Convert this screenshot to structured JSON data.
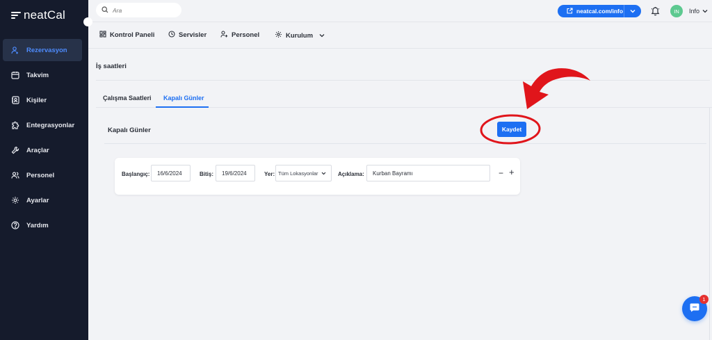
{
  "app": {
    "name": "neatCal"
  },
  "sidebar": {
    "items": [
      {
        "label": "Rezervasyon",
        "icon": "user-calendar-icon",
        "active": true
      },
      {
        "label": "Takvim",
        "icon": "calendar-icon"
      },
      {
        "label": "Kişiler",
        "icon": "contacts-icon"
      },
      {
        "label": "Entegrasyonlar",
        "icon": "puzzle-icon"
      },
      {
        "label": "Araçlar",
        "icon": "tools-icon"
      },
      {
        "label": "Personel",
        "icon": "users-icon"
      },
      {
        "label": "Ayarlar",
        "icon": "gear-icon"
      },
      {
        "label": "Yardım",
        "icon": "help-icon"
      }
    ]
  },
  "topbar": {
    "search_placeholder": "Ara",
    "url_label": "neatcal.com/info",
    "avatar_initials": "IN",
    "user_name": "Info"
  },
  "subnav": {
    "items": [
      {
        "label": "Kontrol Paneli",
        "icon": "dashboard-icon"
      },
      {
        "label": "Servisler",
        "icon": "clock-icon"
      },
      {
        "label": "Personel",
        "icon": "user-add-icon"
      },
      {
        "label": "Kurulum",
        "icon": "settings-icon"
      }
    ]
  },
  "page": {
    "title": "İş saatleri",
    "tabs": [
      {
        "label": "Çalışma Saatleri",
        "active": false
      },
      {
        "label": "Kapalı Günler",
        "active": true
      }
    ],
    "section_title": "Kapalı Günler",
    "save_label": "Kaydet"
  },
  "closed_day": {
    "start_label": "Başlangıç:",
    "start_value": "16/6/2024",
    "end_label": "Bitiş:",
    "end_value": "19/6/2024",
    "location_label": "Yer:",
    "location_value": "Tüm Lokasyonlar",
    "description_label": "Açıklama:",
    "description_value": "Kurban Bayramı"
  },
  "chat": {
    "badge_count": "1"
  },
  "colors": {
    "sidebar_bg": "#151b2c",
    "accent": "#1d6ff2",
    "annotation_red": "#e0151b",
    "avatar": "#5dc990",
    "background": "#f2f3f6"
  }
}
